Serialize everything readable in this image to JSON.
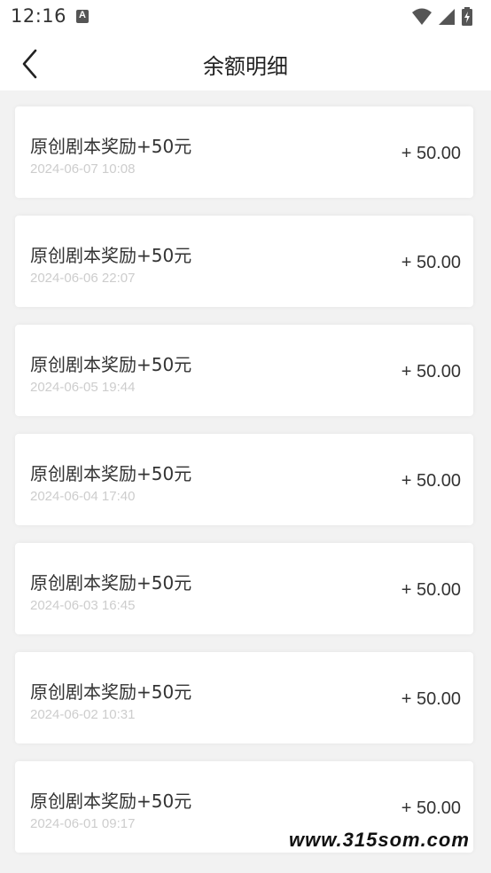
{
  "status_bar": {
    "time": "12:16",
    "app_icon": "a-icon",
    "icons": [
      "wifi-icon",
      "signal-icon",
      "battery-icon"
    ]
  },
  "header": {
    "title": "余额明细",
    "back_icon": "chevron-left-icon"
  },
  "transactions": [
    {
      "title": "原创剧本奖励+50元",
      "time": "2024-06-07 10:08",
      "amount": "+ 50.00"
    },
    {
      "title": "原创剧本奖励+50元",
      "time": "2024-06-06 22:07",
      "amount": "+ 50.00"
    },
    {
      "title": "原创剧本奖励+50元",
      "time": "2024-06-05 19:44",
      "amount": "+ 50.00"
    },
    {
      "title": "原创剧本奖励+50元",
      "time": "2024-06-04 17:40",
      "amount": "+ 50.00"
    },
    {
      "title": "原创剧本奖励+50元",
      "time": "2024-06-03 16:45",
      "amount": "+ 50.00"
    },
    {
      "title": "原创剧本奖励+50元",
      "time": "2024-06-02 10:31",
      "amount": "+ 50.00"
    },
    {
      "title": "原创剧本奖励+50元",
      "time": "2024-06-01 09:17",
      "amount": "+ 50.00"
    }
  ],
  "watermark": "www.315som.com",
  "colors": {
    "background": "#f2f2f2",
    "card": "#ffffff",
    "text_primary": "#333333",
    "text_secondary": "#cdcdcd"
  }
}
